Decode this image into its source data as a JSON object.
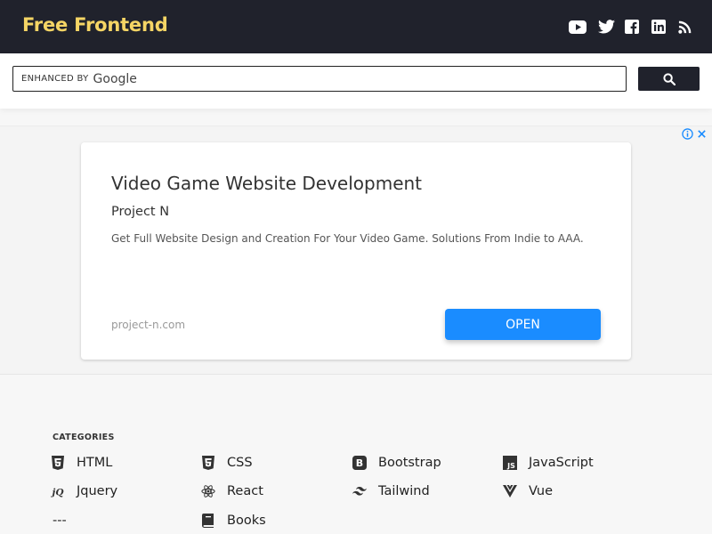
{
  "brand": {
    "name": "Free Frontend",
    "accent": "#f5d565",
    "bar_color": "#20222c"
  },
  "social": [
    {
      "name": "youtube-icon"
    },
    {
      "name": "twitter-icon"
    },
    {
      "name": "facebook-icon"
    },
    {
      "name": "linkedin-icon"
    },
    {
      "name": "rss-icon"
    }
  ],
  "search": {
    "enhanced_by": "ENHANCED BY",
    "google": "Google",
    "button_icon": "search-icon"
  },
  "ad": {
    "title": "Video Game Website Development",
    "advertiser": "Project N",
    "description": "Get Full Website Design and Creation For Your Video Game. Solutions From Indie to AAA.",
    "url": "project-n.com",
    "cta": "OPEN",
    "cta_color": "#1a8cff"
  },
  "categories": {
    "heading": "CATEGORIES",
    "items": [
      {
        "label": "HTML",
        "icon": "html5-icon"
      },
      {
        "label": "CSS",
        "icon": "css3-icon"
      },
      {
        "label": "Bootstrap",
        "icon": "bootstrap-icon"
      },
      {
        "label": "JavaScript",
        "icon": "javascript-icon"
      },
      {
        "label": "Jquery",
        "icon": "jquery-icon"
      },
      {
        "label": "React",
        "icon": "react-icon"
      },
      {
        "label": "Tailwind",
        "icon": "tailwind-icon"
      },
      {
        "label": "Vue",
        "icon": "vue-icon"
      },
      {
        "label": "---",
        "icon": ""
      },
      {
        "label": "Books",
        "icon": "book-icon"
      }
    ]
  }
}
